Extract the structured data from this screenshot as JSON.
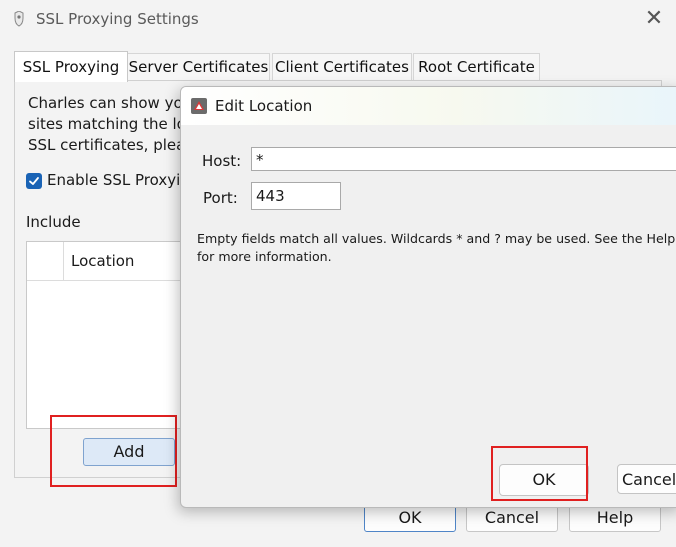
{
  "window": {
    "title": "SSL Proxying Settings",
    "close_glyph": "✕"
  },
  "tabs": [
    {
      "label": "SSL Proxying",
      "selected": true
    },
    {
      "label": "Server Certificates",
      "selected": false
    },
    {
      "label": "Client Certificates",
      "selected": false
    },
    {
      "label": "Root Certificate",
      "selected": false
    }
  ],
  "ssl_tab": {
    "description": "Charles can show you\nsites matching the lo\nSSL certificates, pleas",
    "enable_label": "Enable SSL Proxyir",
    "enable_checked": true,
    "include_label": "Include",
    "table": {
      "columns": [
        "",
        "Location"
      ],
      "rows": []
    },
    "add_label": "Add"
  },
  "footer": {
    "ok_label": "OK",
    "cancel_label": "Cancel",
    "help_label": "Help"
  },
  "dialog": {
    "title": "Edit Location",
    "host_label": "Host:",
    "host_value": "*",
    "port_label": "Port:",
    "port_value": "443",
    "help_text": "Empty fields match all values. Wildcards * and ? may be used. See the Help for more information.",
    "ok_label": "OK",
    "cancel_label": "Cancel"
  },
  "colors": {
    "highlight": "#e02020",
    "accent": "#1a63b5"
  }
}
